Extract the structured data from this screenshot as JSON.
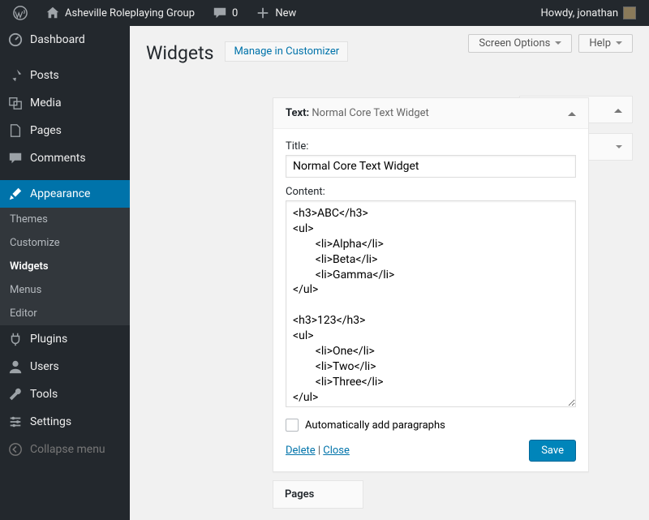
{
  "adminbar": {
    "site_name": "Asheville Roleplaying Group",
    "comments_count": "0",
    "new_label": "New",
    "howdy": "Howdy, jonathan"
  },
  "sidebar": {
    "dashboard": "Dashboard",
    "posts": "Posts",
    "media": "Media",
    "pages": "Pages",
    "comments": "Comments",
    "appearance": "Appearance",
    "appearance_sub": {
      "themes": "Themes",
      "customize": "Customize",
      "widgets": "Widgets",
      "menus": "Menus",
      "editor": "Editor"
    },
    "plugins": "Plugins",
    "users": "Users",
    "tools": "Tools",
    "settings": "Settings",
    "collapse": "Collapse menu"
  },
  "header": {
    "title": "Widgets",
    "customizer_link": "Manage in Customizer",
    "screen_options": "Screen Options",
    "help": "Help"
  },
  "widget": {
    "type_label": "Text:",
    "name": "Normal Core Text Widget",
    "title_label": "Title:",
    "title_value": "Normal Core Text Widget",
    "content_label": "Content:",
    "content_value": "<h3>ABC</h3>\n<ul>\n        <li>Alpha</li>\n        <li>Beta</li>\n        <li>Gamma</li>\n</ul>\n\n<h3>123</h3>\n<ul>\n        <li>One</li>\n        <li>Two</li>\n        <li>Three</li>\n</ul>",
    "autop_label": "Automatically add paragraphs",
    "delete": "Delete",
    "close": "Close",
    "save": "Save"
  },
  "bottom_panel": "Pages"
}
